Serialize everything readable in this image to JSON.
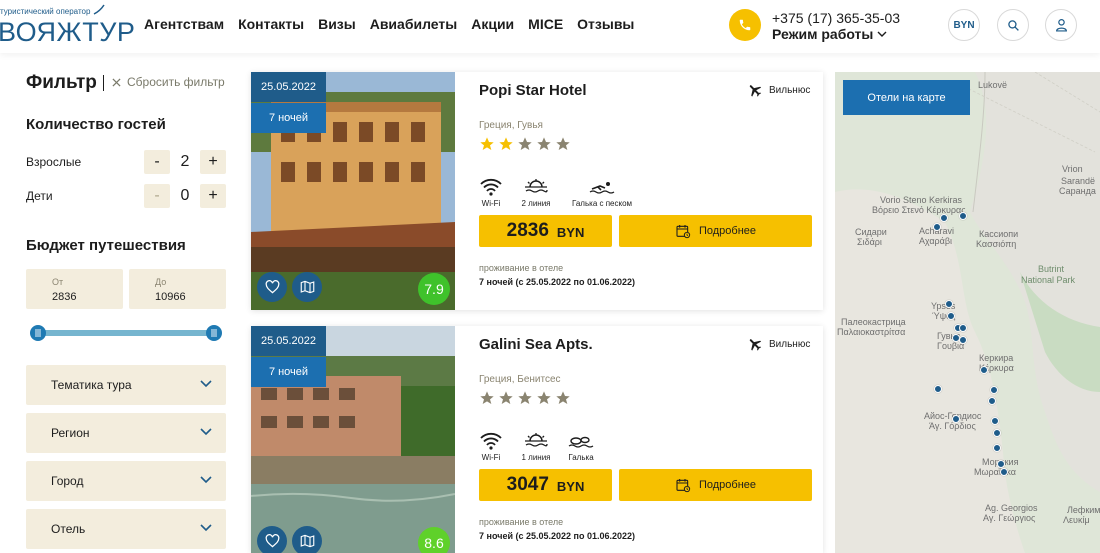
{
  "header": {
    "logo_sub": "туристический оператор",
    "logo_main": "ВОЯЖТУР",
    "nav": [
      "Агентствам",
      "Контакты",
      "Визы",
      "Авиабилеты",
      "Акции",
      "MICE",
      "Отзывы"
    ],
    "phone": "+375 (17) 365-35-03",
    "work_hours": "Режим работы",
    "currency": "BYN"
  },
  "filter": {
    "title": "Фильтр",
    "reset": "Сбросить фильтр",
    "guests_title": "Количество гостей",
    "adults_label": "Взрослые",
    "adults_value": "2",
    "children_label": "Дети",
    "children_value": "0",
    "budget_title": "Бюджет путешествия",
    "budget_from_label": "От",
    "budget_from_value": "2836",
    "budget_to_label": "До",
    "budget_to_value": "10966",
    "dropdowns": [
      "Тематика тура",
      "Регион",
      "Город",
      "Отель"
    ]
  },
  "hotels": [
    {
      "date": "25.05.2022",
      "nights": "7 ночей",
      "name": "Popi Star Hotel",
      "departure": "Вильнюс",
      "location": "Греция, Гувья",
      "stars_filled": 2,
      "stars_total": 5,
      "amenities": [
        "Wi-Fi",
        "2 линия",
        "Галька с песком"
      ],
      "price": "2836",
      "currency": "BYN",
      "more": "Подробнее",
      "stay_label": "проживание в отеле",
      "stay_value": "7 ночей (с 25.05.2022 по 01.06.2022)",
      "rating": "7.9"
    },
    {
      "date": "25.05.2022",
      "nights": "7 ночей",
      "name": "Galini Sea Apts.",
      "departure": "Вильнюс",
      "location": "Греция, Бенитсес",
      "stars_filled": 0,
      "stars_total": 5,
      "amenities": [
        "Wi-Fi",
        "1 линия",
        "Галька"
      ],
      "price": "3047",
      "currency": "BYN",
      "more": "Подробнее",
      "stay_label": "проживание в отеле",
      "stay_value": "7 ночей (с 25.05.2022 по 01.06.2022)",
      "rating": "8.6"
    }
  ],
  "map": {
    "button": "Отели на карте",
    "labels": [
      "Lukovë",
      "Vrion",
      "Sarandë",
      "Саранда",
      "Vorio Steno Kerkiras",
      "Βόρειο Στενό Κέρκυρας",
      "Сидари",
      "Σιδάρι",
      "Acharavi",
      "Αχαράβι",
      "Кассиопи",
      "Κασσιόπη",
      "Butrint",
      "National Park",
      "Ypsos",
      "Ύψος",
      "Палеокастрица",
      "Παλαιοκαστρίτσα",
      "Гувья",
      "Γουβιά",
      "Керкира",
      "Κέρκυρα",
      "Айос-Гордиос",
      "Άγ. Γόρδιος",
      "Моракия",
      "Μωραΐτικα",
      "Ag. Georgios",
      "Αγ. Γεώργιος",
      "Лефким",
      "Λευκίμ"
    ],
    "colors": {
      "accent": "#f6c000",
      "brand": "#1f5c8a",
      "button": "#1c6fb0",
      "rating": "#3fc22b",
      "panel": "#f3eddd"
    }
  }
}
